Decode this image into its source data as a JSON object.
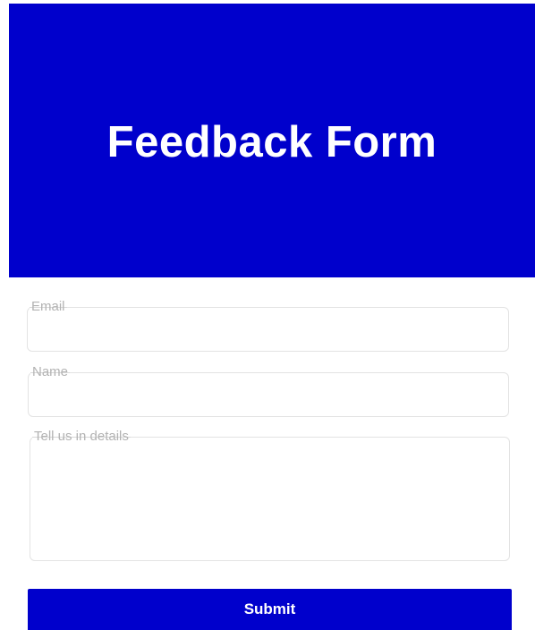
{
  "header": {
    "title": "Feedback Form"
  },
  "form": {
    "email": {
      "label": "Email",
      "value": ""
    },
    "name": {
      "label": "Name",
      "value": ""
    },
    "details": {
      "label": "Tell us in details",
      "value": ""
    },
    "submit_label": "Submit"
  },
  "colors": {
    "brand": "#0000cc",
    "background": "#ffffff",
    "label": "#b3b3b3",
    "field_border": "#e3e3e3"
  }
}
